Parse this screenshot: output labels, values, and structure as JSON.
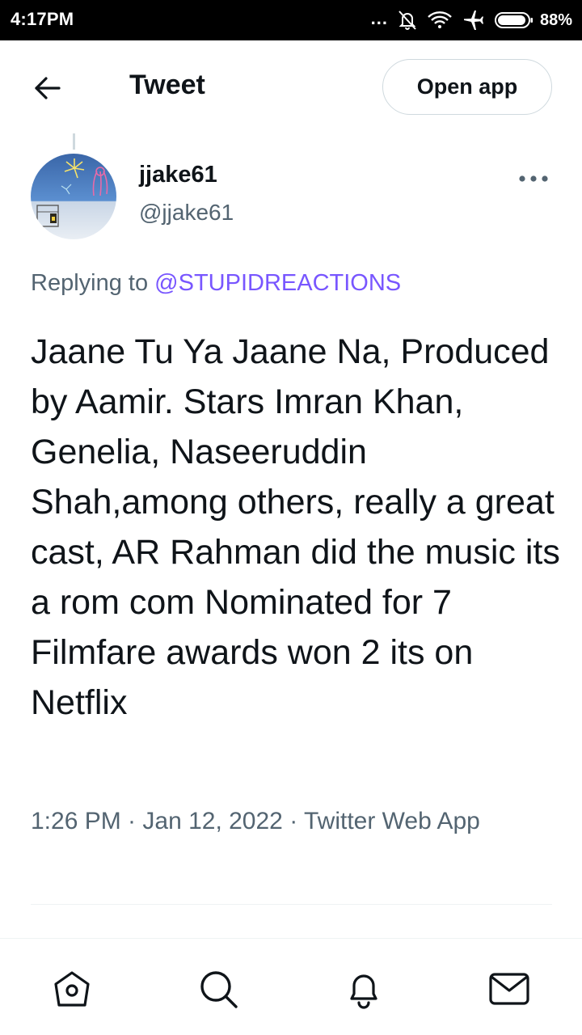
{
  "status_bar": {
    "time": "4:17PM",
    "dots": "...",
    "battery_percent": "88%",
    "icons": [
      "notifications-off-icon",
      "wifi-icon",
      "airplane-mode-icon",
      "battery-icon"
    ]
  },
  "header": {
    "title": "Tweet",
    "open_app_label": "Open app",
    "back_icon": "arrow-left-icon"
  },
  "tweet": {
    "author_name": "jjake61",
    "author_handle": "@jjake61",
    "replying_prefix": "Replying to ",
    "replying_to": "@STUPIDREACTIONS",
    "text": "Jaane Tu Ya Jaane Na, Produced by Aamir. Stars Imran Khan, Genelia, Naseeruddin Shah,among others, really a great cast, AR Rahman did the music its a rom com Nominated for 7 Filmfare awards won 2 its on Netflix",
    "meta": "1:26 PM · Jan 12, 2022 · Twitter Web App"
  },
  "bottom_nav": {
    "items": [
      "home-icon",
      "search-icon",
      "notifications-icon",
      "messages-icon"
    ]
  },
  "colors": {
    "link": "#7856ff",
    "secondary_text": "#536471",
    "primary_text": "#0f1419",
    "border": "#cfd9de"
  }
}
